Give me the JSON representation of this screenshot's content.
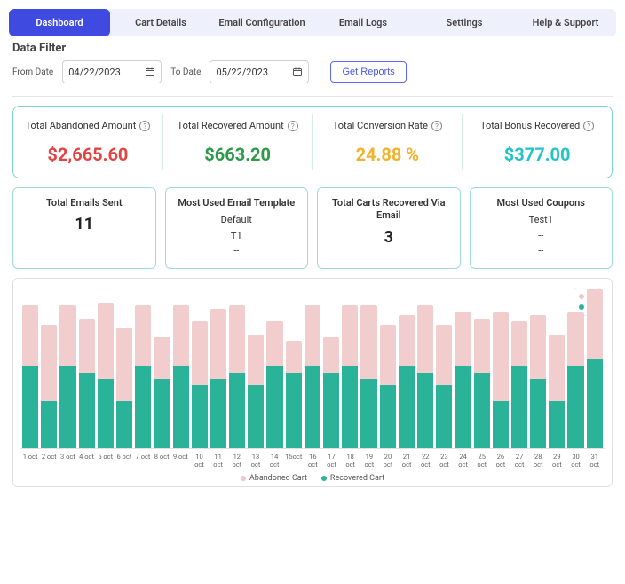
{
  "tabs": [
    "Dashboard",
    "Cart Details",
    "Email Configuration",
    "Email Logs",
    "Settings",
    "Help & Support"
  ],
  "active_tab": 0,
  "filter": {
    "title": "Data Filter",
    "from_label": "From Date",
    "from_value": "04/22/2023",
    "to_label": "To Date",
    "to_value": "05/22/2023",
    "button": "Get Reports"
  },
  "stats": [
    {
      "title": "Total Abandoned Amount",
      "value": "$2,665.60",
      "cls": "v-red"
    },
    {
      "title": "Total Recovered Amount",
      "value": "$663.20",
      "cls": "v-green"
    },
    {
      "title": "Total Conversion Rate",
      "value": "24.88 %",
      "cls": "v-yellow"
    },
    {
      "title": "Total Bonus Recovered",
      "value": "$377.00",
      "cls": "v-teal"
    }
  ],
  "info_cards": [
    {
      "title": "Total Emails Sent",
      "lines": [],
      "big": "11"
    },
    {
      "title": "Most Used Email Template",
      "lines": [
        "Default",
        "T1",
        "--"
      ],
      "big": ""
    },
    {
      "title": "Total Carts Recovered Via Email",
      "lines": [],
      "big": "3"
    },
    {
      "title": "Most Used Coupons",
      "lines": [
        "Test1",
        "--",
        "--"
      ],
      "big": ""
    }
  ],
  "chart_legend_box": {
    "top": "90",
    "bot": "65"
  },
  "chart_bottom_legend": {
    "a": "Abandoned Cart",
    "b": "Recovered Cart"
  },
  "chart_data": {
    "type": "bar",
    "title": "",
    "xlabel": "",
    "ylabel": "",
    "ylim": [
      0,
      100
    ],
    "categories": [
      "1 oct",
      "2 oct",
      "3 oct",
      "4 oct",
      "5 oct",
      "6 oct",
      "7 oct",
      "8 oct",
      "9 oct",
      "10 oct",
      "11 oct",
      "12 oct",
      "13 oct",
      "14 oct",
      "15oct",
      "16 oct",
      "17 oct",
      "18 oct",
      "19 oct",
      "20 oct",
      "21 oct",
      "22 oct",
      "23 oct",
      "24 oct",
      "25 oct",
      "26 oct",
      "27 oct",
      "28 oct",
      "29 oct",
      "30 oct",
      "31 oct"
    ],
    "series": [
      {
        "name": "Abandoned Cart",
        "values": [
          90,
          78,
          90,
          82,
          92,
          76,
          90,
          70,
          90,
          80,
          88,
          90,
          72,
          80,
          68,
          90,
          70,
          90,
          90,
          78,
          84,
          90,
          78,
          86,
          82,
          86,
          80,
          84,
          72,
          86,
          100
        ]
      },
      {
        "name": "Recovered Cart",
        "values": [
          52,
          30,
          52,
          48,
          44,
          30,
          52,
          44,
          52,
          40,
          44,
          48,
          40,
          52,
          48,
          52,
          48,
          52,
          44,
          40,
          52,
          48,
          40,
          52,
          48,
          30,
          52,
          44,
          30,
          52,
          56
        ]
      }
    ]
  }
}
